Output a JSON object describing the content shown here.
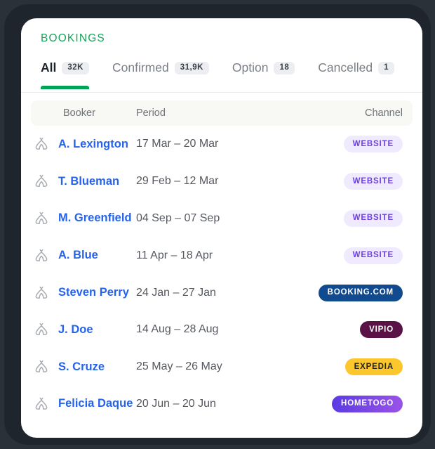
{
  "header": {
    "title": "BOOKINGS",
    "title_color": "#16a45a"
  },
  "tabs": [
    {
      "label": "All",
      "count": "32K",
      "active": true
    },
    {
      "label": "Confirmed",
      "count": "31,9K",
      "active": false
    },
    {
      "label": "Option",
      "count": "18",
      "active": false
    },
    {
      "label": "Cancelled",
      "count": "1",
      "active": false
    }
  ],
  "table": {
    "columns": {
      "booker": "Booker",
      "period": "Period",
      "channel": "Channel"
    },
    "rows": [
      {
        "icon": "tent-icon",
        "booker": "A. Lexington",
        "period": "17 Mar – 20 Mar",
        "channel": "WEBSITE",
        "channel_style": "website"
      },
      {
        "icon": "tent-icon",
        "booker": "T. Blueman",
        "period": "29 Feb – 12 Mar",
        "channel": "WEBSITE",
        "channel_style": "website"
      },
      {
        "icon": "tent-icon",
        "booker": "M. Greenfield",
        "period": "04 Sep – 07 Sep",
        "channel": "WEBSITE",
        "channel_style": "website"
      },
      {
        "icon": "tent-icon",
        "booker": "A. Blue",
        "period": "11 Apr – 18 Apr",
        "channel": "WEBSITE",
        "channel_style": "website"
      },
      {
        "icon": "tent-icon",
        "booker": "Steven Perry",
        "period": "24 Jan – 27 Jan",
        "channel": "BOOKING.COM",
        "channel_style": "booking"
      },
      {
        "icon": "tent-icon",
        "booker": "J. Doe",
        "period": "14 Aug – 28 Aug",
        "channel": "VIPIO",
        "channel_style": "vipio"
      },
      {
        "icon": "tent-icon",
        "booker": "S. Cruze",
        "period": "25 May – 26 May",
        "channel": "EXPEDIA",
        "channel_style": "expedia"
      },
      {
        "icon": "tent-icon",
        "booker": "Felicia Daque",
        "period": "20 Jun – 20 Jun",
        "channel": "HOMETOGO",
        "channel_style": "hometogo"
      }
    ]
  },
  "colors": {
    "accent_green": "#00a355",
    "link_blue": "#2563eb",
    "website_bg": "#efeafd",
    "website_fg": "#6d3fe6",
    "booking_bg": "#114a8e",
    "vipio_bg": "#5a1146",
    "expedia_bg": "#fcc72c",
    "hometogo_from": "#5b3ce2",
    "hometogo_to": "#9a52e8",
    "card_bg": "#ffffff",
    "frame_bg": "#1f252c"
  }
}
